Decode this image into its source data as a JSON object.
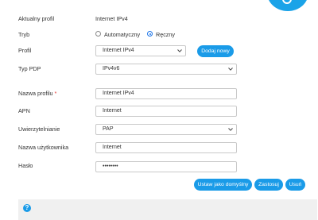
{
  "labels": {
    "current_profile": "Aktualny profil",
    "mode": "Tryb",
    "profile": "Profil",
    "pdp_type": "Typ PDP",
    "profile_name": "Nazwa profilu",
    "apn": "APN",
    "auth": "Uwierzytelnianie",
    "username": "Nazwa użytkownika",
    "password": "Hasło"
  },
  "required_mark": "*",
  "values": {
    "current_profile": "Internet IPv4",
    "mode_automatic": "Automatyczny",
    "mode_manual": "Ręczny",
    "mode_selected": "manual",
    "profile_select": "Internet IPv4",
    "pdp_select": "IPv4v6",
    "profile_name": "Internet IPv4",
    "apn": "Internet",
    "auth_select": "PAP",
    "username": "Internet",
    "password": "••••••••"
  },
  "buttons": {
    "add_new": "Dodaj nowy",
    "set_default": "Ustaw jako domyślny",
    "apply": "Zastosuj",
    "delete": "Usuń"
  },
  "help": {
    "icon": "?"
  },
  "colors": {
    "accent": "#1a9be8",
    "corner": "#1aa3e8",
    "help_bar": "#f0f0f0"
  },
  "icons": {
    "corner": "gear-icon",
    "select_arrow": "chevron-down-icon"
  }
}
